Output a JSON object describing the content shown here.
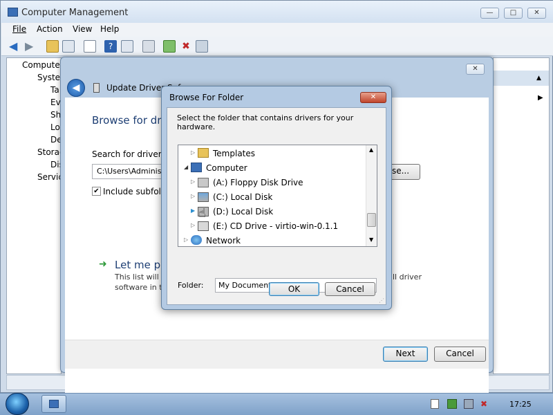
{
  "app": {
    "title": "Computer Management",
    "controls": {
      "minimize": "—",
      "maximize": "□",
      "close": "✕"
    }
  },
  "menu": [
    "File",
    "Action",
    "View",
    "Help"
  ],
  "tree": {
    "items": [
      {
        "label": "Computer",
        "level": 0
      },
      {
        "label": "System",
        "level": 1
      },
      {
        "label": "Ta",
        "level": 2
      },
      {
        "label": "Eve",
        "level": 2
      },
      {
        "label": "Sh",
        "level": 2
      },
      {
        "label": "Lo",
        "level": 2
      },
      {
        "label": "De",
        "level": 2
      },
      {
        "label": "Storag",
        "level": 1
      },
      {
        "label": "Dis",
        "level": 2
      },
      {
        "label": "Service",
        "level": 1
      }
    ]
  },
  "wizard": {
    "title": "Update Driver Sof",
    "heading": "Browse for driv",
    "search_label": "Search for driver so",
    "path_value": "C:\\Users\\Administ",
    "browse_button": "se...",
    "include_subfolders": "Include subfolde",
    "pick_title": "Let me pic",
    "pick_desc_1": "This list will s",
    "pick_desc_2": "software in th",
    "pick_desc_right": "ll driver",
    "next_button": "Next",
    "cancel_button": "Cancel"
  },
  "browse": {
    "title": "Browse For Folder",
    "instruction": "Select the folder that contains drivers for your hardware.",
    "nodes": [
      {
        "label": "Templates",
        "icon": "templates-folder-icon"
      },
      {
        "label": "Computer",
        "icon": "computer-icon"
      },
      {
        "label": "(A:) Floppy Disk Drive",
        "icon": "floppy-drive-icon"
      },
      {
        "label": "(C:) Local Disk",
        "icon": "local-disk-icon"
      },
      {
        "label": "(D:) Local Disk",
        "icon": "local-disk-icon"
      },
      {
        "label": "(E:) CD Drive - virtio-win-0.1.1",
        "icon": "cd-drive-icon"
      },
      {
        "label": "Network",
        "icon": "network-icon"
      }
    ],
    "folder_label": "Folder:",
    "folder_value": "My Documents",
    "ok_button": "OK",
    "cancel_button": "Cancel"
  },
  "taskbar": {
    "clock": "17:25"
  },
  "colors": {
    "accent": "#1e5aa8",
    "link": "#1e3f74",
    "green_arrow": "#2e9a3a"
  }
}
